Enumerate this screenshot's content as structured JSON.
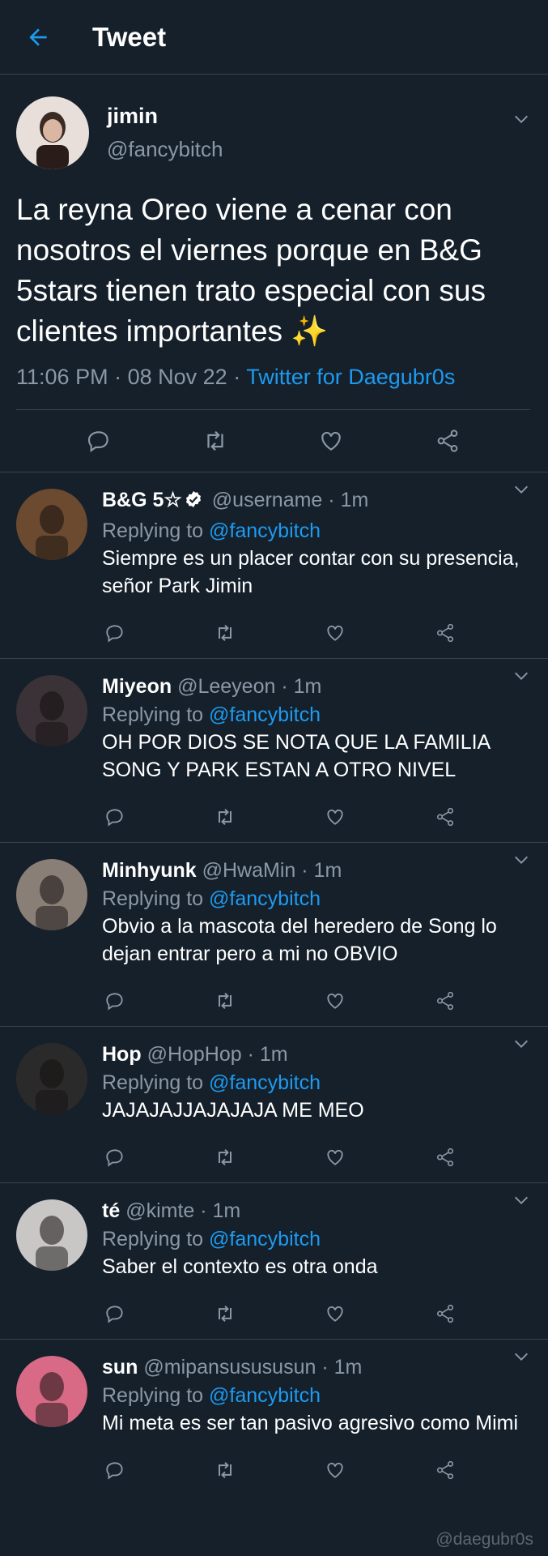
{
  "header": {
    "title": "Tweet"
  },
  "tweet": {
    "name": "jimin",
    "handle": "@fancybitch",
    "text": "La reyna Oreo viene a cenar con nosotros el viernes porque en B&G 5stars tienen trato especial con sus clientes importantes ✨",
    "time": "11:06 PM",
    "date": "08 Nov 22",
    "source": "Twitter for Daegubr0s"
  },
  "replies": [
    {
      "name": "B&G 5☆",
      "handle": "@username",
      "time": "1m",
      "replying_label": "Replying to",
      "replying_to": "@fancybitch",
      "text": "Siempre es un placer contar con su presencia, señor Park Jimin",
      "verified": true,
      "avatar_color": "#6b4a2f"
    },
    {
      "name": "Miyeon",
      "handle": "@Leeyeon",
      "time": "1m",
      "replying_label": "Replying to",
      "replying_to": "@fancybitch",
      "text": "OH POR DIOS SE NOTA QUE LA FAMILIA SONG Y PARK ESTAN A OTRO NIVEL",
      "verified": false,
      "avatar_color": "#3a3236"
    },
    {
      "name": "Minhyunk",
      "handle": "@HwaMin",
      "time": "1m",
      "replying_label": "Replying to",
      "replying_to": "@fancybitch",
      "text": "Obvio a la mascota del heredero de Song lo dejan entrar pero a mi no OBVIO",
      "verified": false,
      "avatar_color": "#8a7f77"
    },
    {
      "name": "Hop",
      "handle": "@HopHop",
      "time": "1m",
      "replying_label": "Replying to",
      "replying_to": "@fancybitch",
      "text": "JAJAJAJJAJAJAJA ME MEO",
      "verified": false,
      "avatar_color": "#2a2a2a"
    },
    {
      "name": "té",
      "handle": "@kimte",
      "time": "1m",
      "replying_label": "Replying to",
      "replying_to": "@fancybitch",
      "text": "Saber el contexto es otra onda",
      "verified": false,
      "avatar_color": "#c9c6c6"
    },
    {
      "name": "sun",
      "handle": "@mipansusususun",
      "time": "1m",
      "replying_label": "Replying to",
      "replying_to": "@fancybitch",
      "text": "Mi meta es ser tan pasivo agresivo como Mimi",
      "verified": false,
      "avatar_color": "#d86a86"
    }
  ],
  "watermark": "@daegubr0s",
  "colors": {
    "background": "#15202b",
    "accent": "#1d9bf0",
    "muted": "#8b98a5",
    "divider": "#38444d"
  },
  "icons": [
    "back-arrow-icon",
    "chevron-down-icon",
    "reply-icon",
    "retweet-icon",
    "like-icon",
    "share-icon",
    "verified-icon"
  ]
}
